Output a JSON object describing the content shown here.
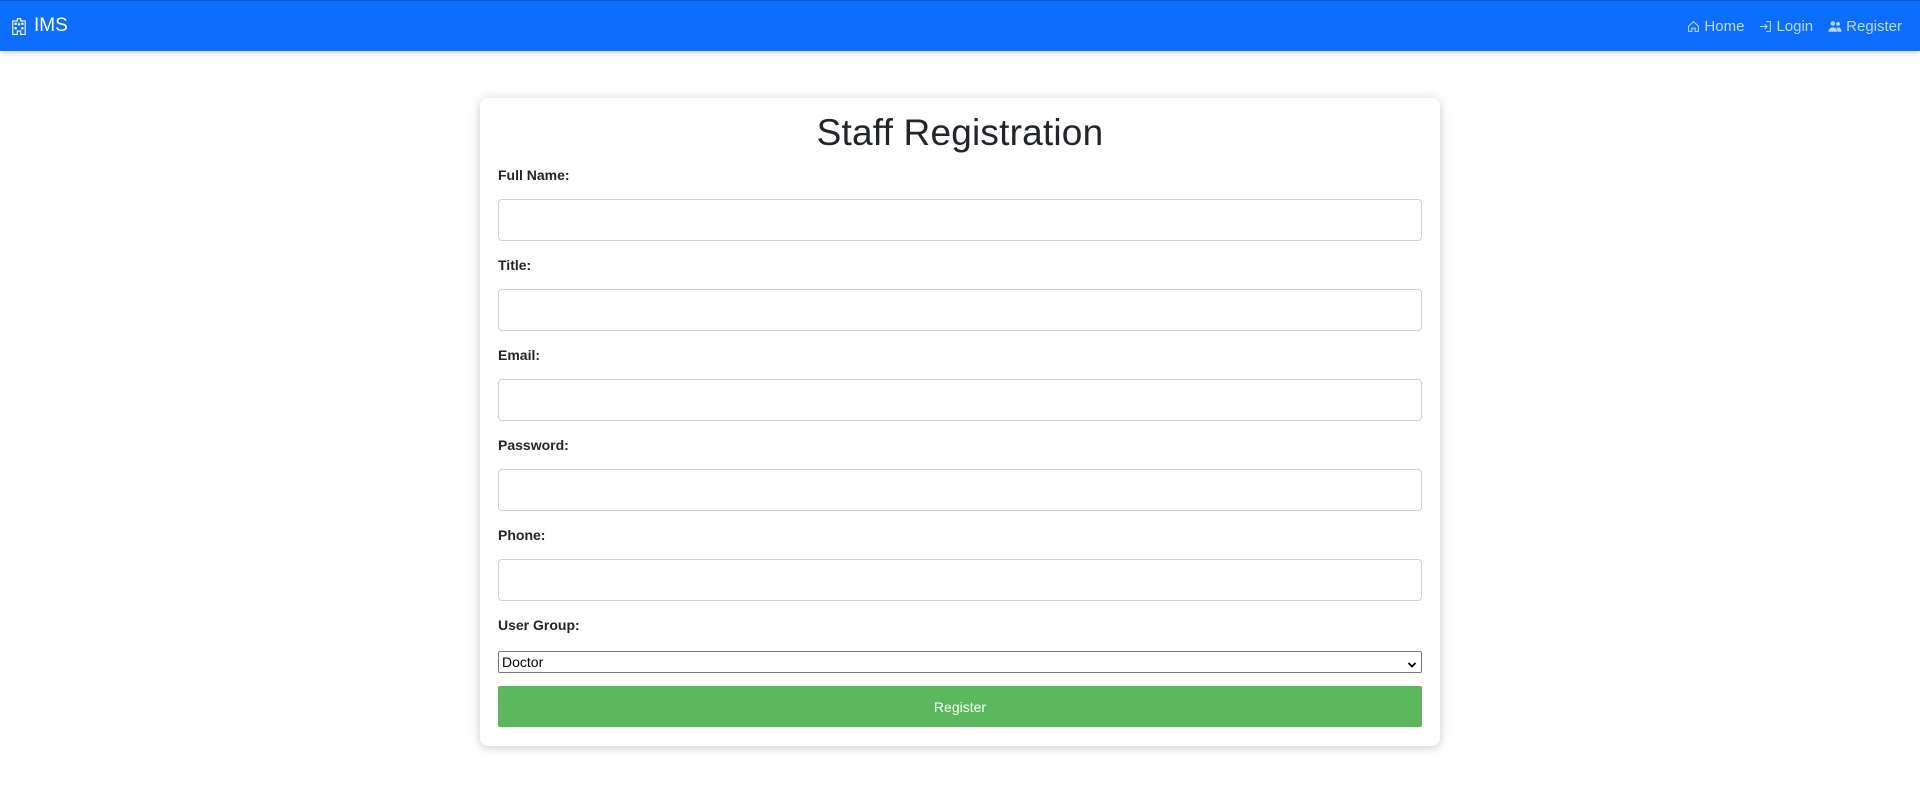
{
  "navbar": {
    "brand": "IMS",
    "brand_icon": "hospital-building-icon",
    "links": [
      {
        "label": "Home",
        "icon": "house-icon"
      },
      {
        "label": "Login",
        "icon": "login-arrow-icon"
      },
      {
        "label": "Register",
        "icon": "people-icon"
      }
    ],
    "color": "#0d6efd"
  },
  "form": {
    "title": "Staff Registration",
    "fields": [
      {
        "label": "Full Name:",
        "value": ""
      },
      {
        "label": "Title:",
        "value": ""
      },
      {
        "label": "Email:",
        "value": ""
      },
      {
        "label": "Password:",
        "value": ""
      },
      {
        "label": "Phone:",
        "value": ""
      }
    ],
    "user_group": {
      "label": "User Group:",
      "selected": "Doctor"
    },
    "submit_label": "Register",
    "submit_color": "#5cb85c"
  }
}
